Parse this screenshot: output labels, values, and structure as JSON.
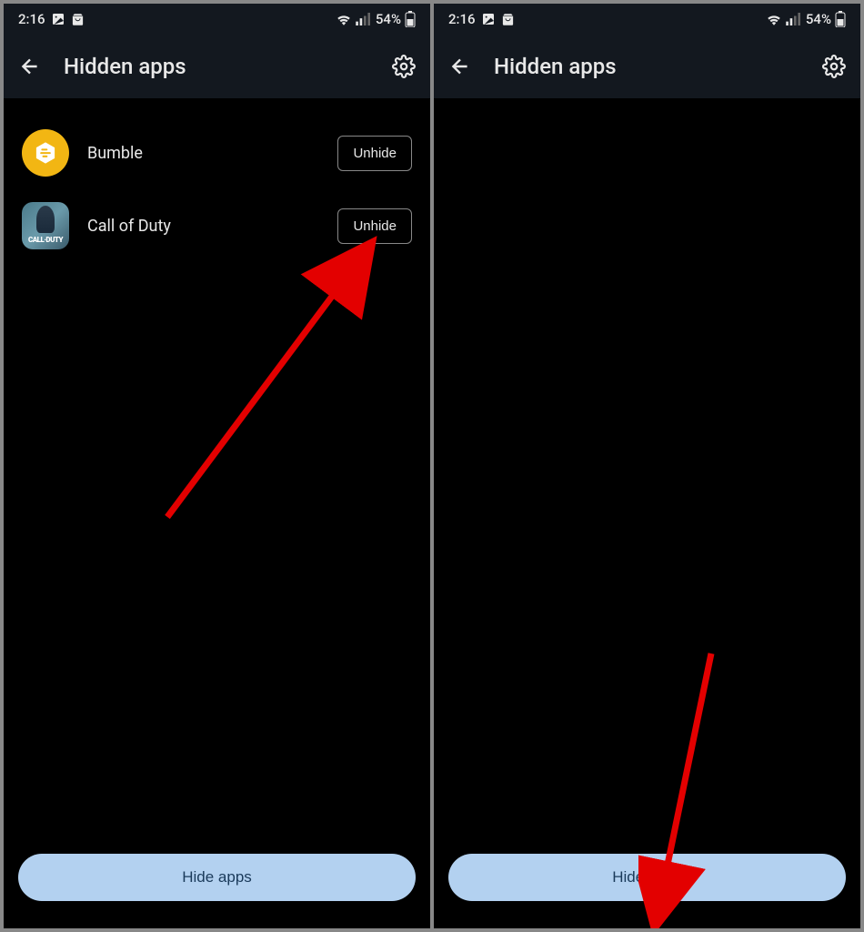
{
  "status": {
    "time": "2:16",
    "battery": "54%"
  },
  "header": {
    "title": "Hidden apps"
  },
  "left_panel": {
    "apps": [
      {
        "name": "Bumble",
        "action": "Unhide",
        "icon": "bumble"
      },
      {
        "name": "Call of Duty",
        "action": "Unhide",
        "icon": "cod",
        "icon_text": "CALL·DUTY"
      }
    ]
  },
  "bottom": {
    "button_label": "Hide apps"
  }
}
